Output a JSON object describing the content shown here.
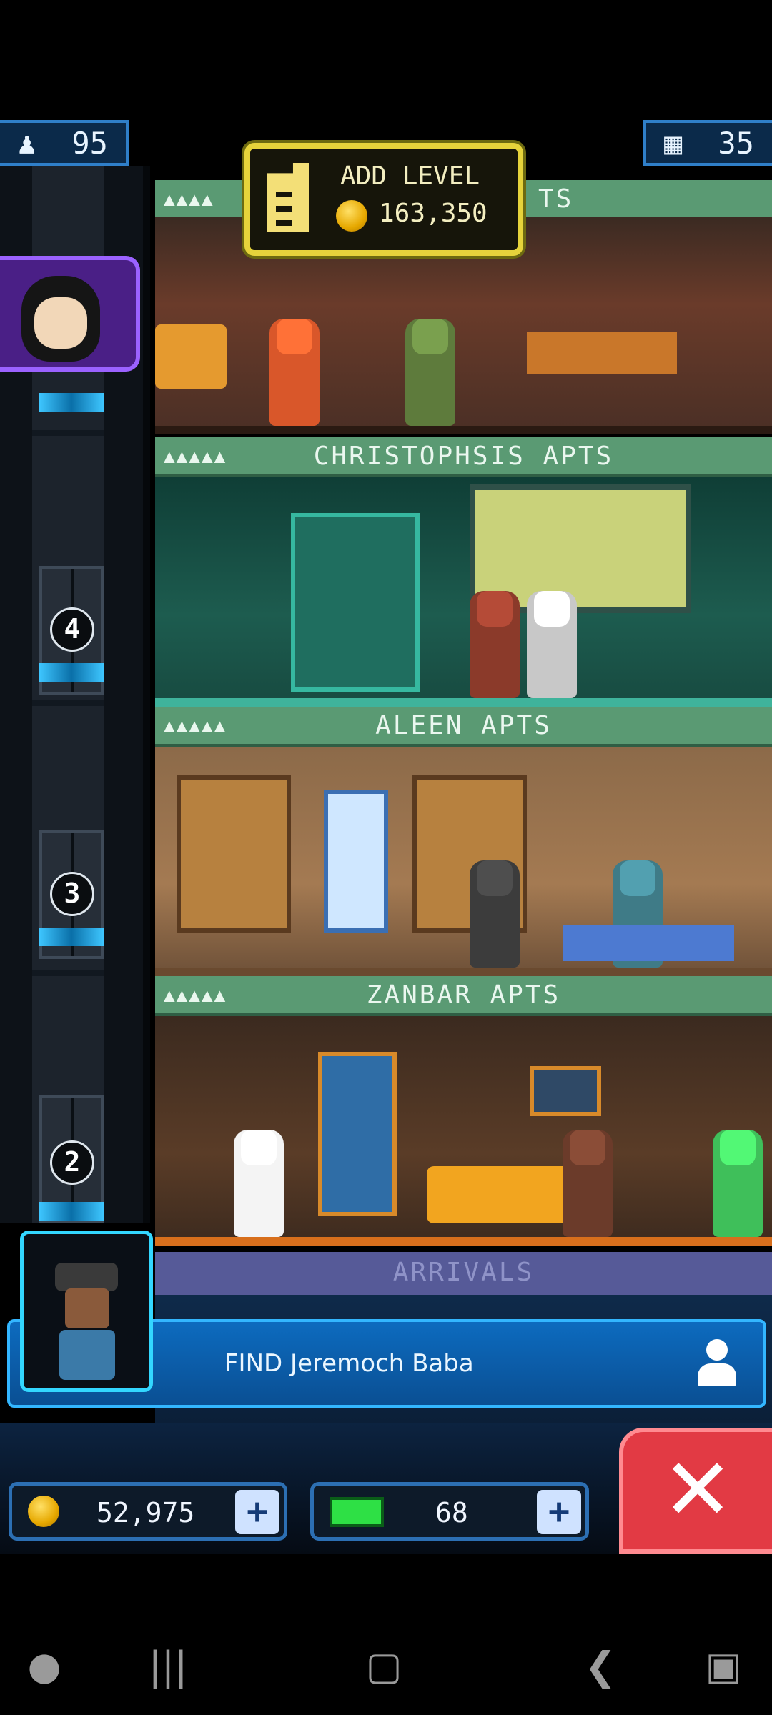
{
  "top_stats": {
    "population": "95",
    "levels": "35"
  },
  "add_level": {
    "label": "ADD LEVEL",
    "cost": "163,350"
  },
  "floors": [
    {
      "name": "CHRISTOPHSIS APTS",
      "stars": "▲▲▲▲▲"
    },
    {
      "name": "ALEEN APTS",
      "stars": "▲▲▲▲▲"
    },
    {
      "name": "ZANBAR APTS",
      "stars": "▲▲▲▲▲"
    }
  ],
  "top_floor": {
    "name_fragment": "TS",
    "stars": "▲▲▲▲"
  },
  "elevator": {
    "floor_numbers": [
      "4",
      "3",
      "2"
    ]
  },
  "arrivals": {
    "label": "ARRIVALS"
  },
  "mission": {
    "text": "FIND Jeremoch Baba"
  },
  "resources": {
    "coins": "52,975",
    "bux": "68",
    "plus": "+"
  },
  "close_symbol": "✕",
  "icons": [
    "person-icon",
    "level-icon",
    "coin-icon",
    "bux-icon",
    "add-level-icon",
    "user-icon",
    "close-icon"
  ],
  "colors": {
    "banner": "#5a9a73",
    "accent": "#33b6ff",
    "close": "#e23a44",
    "gold": "#e6d33b"
  }
}
